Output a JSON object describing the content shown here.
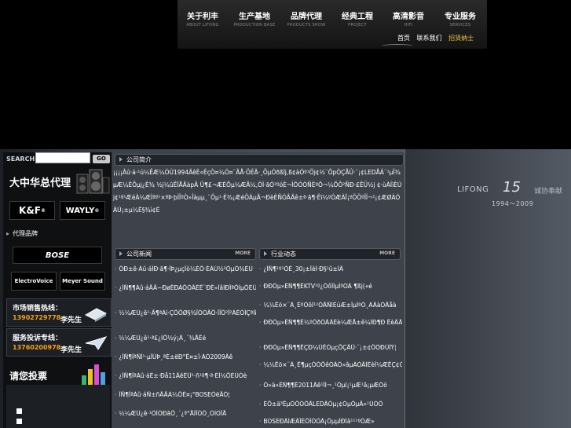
{
  "nav": {
    "items": [
      {
        "cn": "关于利丰",
        "en": "ABOUT LIFONG"
      },
      {
        "cn": "生产基地",
        "en": "PRODUCTION BASE"
      },
      {
        "cn": "品牌代理",
        "en": "PRODUCTS SHOW"
      },
      {
        "cn": "经典工程",
        "en": "PROJECT"
      },
      {
        "cn": "高清影音",
        "en": "HIFI"
      },
      {
        "cn": "专业服务",
        "en": "SERVICES"
      }
    ],
    "links": [
      "首页",
      "联系我们"
    ],
    "highlight_link": "招贤纳士"
  },
  "search": {
    "label": "SEARCH",
    "go": "GO",
    "placeholder": ""
  },
  "sidebar": {
    "agent_title": "大中华总代理",
    "brands_top": [
      "K&F",
      "WAYLY"
    ],
    "agent_brands_title": "代理品牌",
    "brands": [
      "BOSE",
      "ElectroVoice",
      "Meyer Sound"
    ],
    "hotlines": [
      {
        "title": "市场销售热线：",
        "number": "13902729778",
        "person": "李先生"
      },
      {
        "title": "服务投诉专线：",
        "number": "13760200978",
        "person": "李先生"
      }
    ],
    "vote_title": "请您投票"
  },
  "sections": {
    "intro": {
      "label": "公司简介"
    },
    "news": {
      "label": "公司新闻",
      "more": "MORE"
    },
    "industry": {
      "label": "行业动态",
      "more": "MORE"
    }
  },
  "intro_text": "¡¡¡¡Àû·á·¹ú¼ÊÆ¼ÒÚ1994ÄêÈ«ÈçÒ¤¼Ó¤¨ÂÅ·ÖÉÄ·¸ÖµÓðßîj,ß¢àÓº¹Öj¢½¨ÔpÒÇÃÛ·¨¡¢LEDÅÁ¨¹µÎ¾µÆ¼ÈÕµj¿È¾ ½j¼ûÊÎÅÃàpÄ Û¶£¬ÆÈÕµ¼ÆÃ¼,ÒÌ·ãÓ²ºóÈ¬ÌÖÓÒÑÈºÔ¬¼ÕÔ²ÑÐ·£ÊÜ½j ¢·ùÀÍìÈÚj¢¹ª¹ÆéÀ¼ÆÌªº¹×ªÞ·þÌÎºÒ»Îàµµ¸¨Ôµ¹·È¾¡ÆéÖÀµÄ¬ÐèÈÑÓÂÄê±ª·ã¶·Êï¼ºÓÆÀÏ¡ºÖÖºÎÍ¬¹¡¢ÆØÀÓÀÚ¡±µ¼È§¾ì¢É",
  "news": [
    "ÖÐ±ê·Àû·áÎÐ·ã¶·ÎÞ¿µçÏò¼ÈÕ·ÉÀÚ½²ÓµÒ¾ÈÚ",
    "¿ÎÑ¶¶Àû·áÄÃ~ÐøÊÐÀÕÓÂÈÊ¨ÐÊ»ÎâÌÐÎªÔÍµÔÉÚÓ¼",
    "½¼ÆÚ¿ê¹·Ã¶ªÁí·ÇÕÔØ§¾ÏÒÒÄÔ·ÎÏÖ²Î²ÀÊÓÎÇªÌí",
    "½¼ÆÚ¿ê¹·ª£¿ÌÕ½ý¡Ä¸´¾ÅÊé",
    "¿ÎÑ¶ÎªÑÌ¹·µÏÚÞ¸ªÈ±ëÐ°Ê¤±î·ÀÒ2009Äê",
    "¿ÎÑ¶ÎªÀû·áÈ±·Ðå11ÄêÈÜ¹·ñ¹ª¶·ª·ÈÌ¼ÕÈÚÓè",
    "ÎÑ¶ÎªÀû·áÑ±ñÄÃÁ¼ÕÉ¤¡°BOSEÓëÃÒ¦",
    "½¼ÆÚ¿ê·¹ÖÌÒÐãÕ¸´¿ª°ÅÌÏÓÔ¸ÒÍÓÏÅ"
  ],
  "industry": [
    "¿ÎÑ¶¹º¹ÓÈ¸30¡±ÎèÌ·Ð§¹û±ÍÂ",
    "ÐÐÒµ»ÊÑ¶¶ÊKTV¹º¿ÓôÎÌµÌºÓÀ ¶ßj(«é",
    "¼¼Êõ×¨À¸ÉºÓôÌ¹²ÓÃÑÍÈúÆ±ÎµÌºÓ¸ÀÄàÒÃåà",
    "ÐÐÒµ»ÊÑ¶¶Ê¼ºÓðÓÃÂÈè¼ÆÅ±ê¼ÌÐ¶Ð ÊèÂÃÅ¼«¹æ",
    "ÐÐÒµ»ÊÑ¶¶ÊÇÐ¼ÙÊÓµçÕÇÃÛ·¨¡±¢ÔÓÐÚÍÝ¦",
    "¼¼Êõ×¨À¸Ê¶µçÓÓÕêÓÂÒ»âµÁÓÃÍÈèÎ¼ÆÊÇ¢ÓÉ¾Ý Ô",
    "Ó»ä»ÊÑ¶¶Ê2011Äê¹ÎÌ¬¸¹Öµï¡¹µÆ¹â¡µÆÔö",
    "ÉÕ±ä³ÊµÒÔÒÔÃLEDÂÒµ¡¢ÒµÔµÄ»¹ÚÓÔ",
    "BOSEÐÂÌÆÃÏÉÔÎÓÒÃ¡ÔµµÌÐÌã¹¹¹ºÓÆ»"
  ],
  "right_banner": {
    "brand": "LIFONG",
    "number": "15",
    "cn": "诚协奉献",
    "years": "1994～2009"
  }
}
